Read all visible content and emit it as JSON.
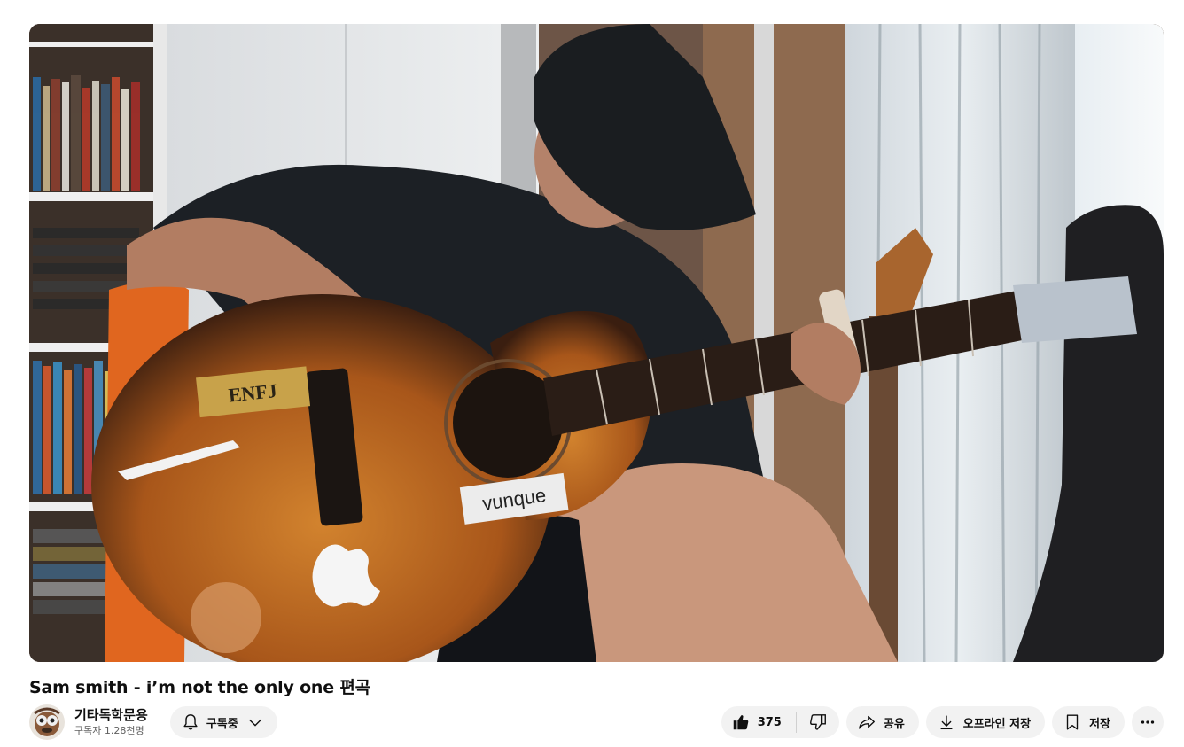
{
  "video": {
    "title": "Sam smith - i’m not the only one 편곡",
    "stickers": {
      "enfj": "ENFJ",
      "vunque": "vunque"
    }
  },
  "channel": {
    "name": "기타독학문용",
    "subscribers": "구독자 1.28천명"
  },
  "subscribe": {
    "label": "구독중"
  },
  "actions": {
    "like_count": "375",
    "share": "공유",
    "download": "오프라인 저장",
    "save": "저장"
  },
  "icons": {
    "bell": "bell-icon",
    "chevron": "chevron-down-icon",
    "like": "thumbs-up-icon",
    "dislike": "thumbs-down-icon",
    "share": "share-arrow-icon",
    "download": "download-icon",
    "save": "bookmark-icon",
    "more": "more-horizontal-icon"
  },
  "colors": {
    "pill_bg": "#f2f2f2",
    "text": "#0f0f0f",
    "secondary_text": "#606060"
  }
}
